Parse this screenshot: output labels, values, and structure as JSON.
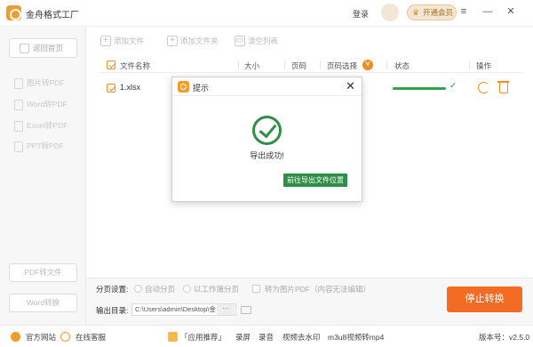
{
  "app": {
    "title": "金舟格式工厂",
    "login": "登录",
    "vip": "开通会员",
    "version": "版本号：v2.5.0"
  },
  "sidebar": {
    "home": "返回首页",
    "items": [
      {
        "label": "图片转PDF"
      },
      {
        "label": "Word转PDF"
      },
      {
        "label": "Excel转PDF"
      },
      {
        "label": "PPT转PDF"
      }
    ],
    "pdf_to_file": "PDF转文件",
    "word_convert": "Word转换"
  },
  "toolbar": {
    "add_file": "添加文件",
    "add_folder": "添加文件夹",
    "clear_list": "清空列表"
  },
  "table": {
    "headers": {
      "name": "文件名称",
      "size": "大小",
      "pages": "页码",
      "page_select": "页码选择",
      "status": "状态",
      "actions": "操作"
    },
    "badge": "V",
    "rows": [
      {
        "name": "1.xlsx",
        "progress": 1.0
      }
    ]
  },
  "options": {
    "paging_label": "分页设置:",
    "auto_paging": "自动分页",
    "sheet_paging": "以工作簿分页",
    "to_image_pdf": "转为图片PDF（内容无法编辑）",
    "output_label": "输出目录:",
    "output_path": "C:\\Users\\admin\\Desktop\\金",
    "more": "···"
  },
  "stop_button": "停止转换",
  "statusbar": {
    "site": "官方网站",
    "service": "在线客服",
    "recommend": "「应用推荐」",
    "record": "录屏",
    "audio": "录音",
    "watermark": "视频去水印",
    "m3u8": "m3u8视频转mp4"
  },
  "modal": {
    "title": "提示",
    "message": "导出成功!",
    "button": "前往导出文件位置"
  },
  "colors": {
    "accent": "#f46c24",
    "success": "#2e8f47"
  }
}
